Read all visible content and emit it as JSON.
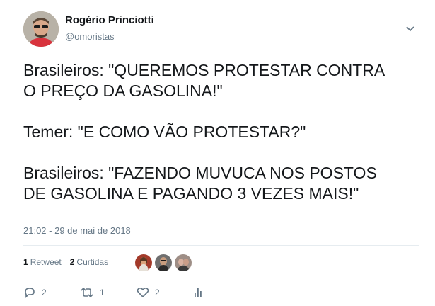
{
  "author": {
    "name": "Rogério Princiotti",
    "handle": "@omoristas"
  },
  "tweet": {
    "text": "Brasileiros: \"QUEREMOS PROTESTAR CONTRA\nO PREÇO DA GASOLINA!\"\n\nTemer: \"E COMO VÃO PROTESTAR?\"\n\nBrasileiros: \"FAZENDO MUVUCA NOS POSTOS\nDE GASOLINA E PAGANDO 3 VEZES MAIS!\"",
    "timestamp": "21:02 - 29 de mai de 2018"
  },
  "stats": {
    "retweets_count": "1",
    "retweets_label": "Retweet",
    "likes_count": "2",
    "likes_label": "Curtidas"
  },
  "actions": {
    "reply_count": "2",
    "retweet_count": "1",
    "like_count": "2"
  },
  "icons": {
    "caret": "chevron-down-icon",
    "reply": "reply-icon",
    "retweet": "retweet-icon",
    "like": "heart-icon",
    "analytics": "analytics-icon"
  },
  "colors": {
    "text": "#14171a",
    "secondary": "#657786",
    "divider": "#e6ecf0"
  }
}
